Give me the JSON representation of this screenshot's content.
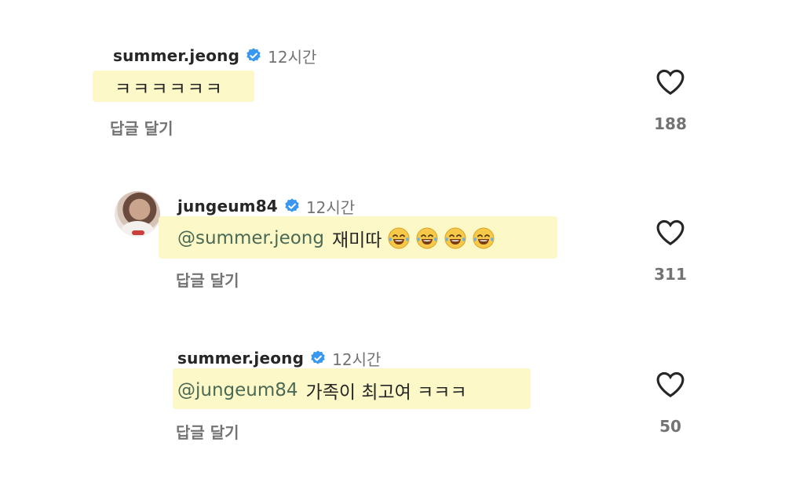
{
  "comments": [
    {
      "username": "summer.jeong",
      "time": "12시간",
      "text": "ㅋㅋㅋㅋㅋㅋ",
      "reply_label": "답글 달기",
      "likes": "188"
    },
    {
      "username": "jungeum84",
      "time": "12시간",
      "mention": "@summer.jeong",
      "text": "재미따",
      "reply_label": "답글 달기",
      "likes": "311",
      "emoji_count": 4,
      "emoji_icon": "face-with-tears-of-joy"
    },
    {
      "username": "summer.jeong",
      "time": "12시간",
      "mention": "@jungeum84",
      "text": "가족이 최고여 ㅋㅋㅋ",
      "reply_label": "답글 달기",
      "likes": "50"
    }
  ],
  "colors": {
    "highlight": "#fdf8c8",
    "verified_badge": "#3897f0",
    "mention": "#4a6a55",
    "muted": "#737373"
  }
}
